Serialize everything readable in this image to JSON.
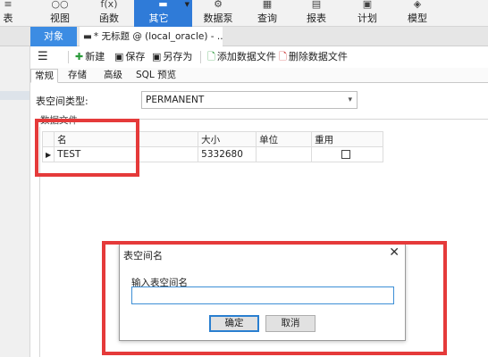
{
  "ribbon": {
    "items": [
      {
        "label": "表",
        "icon": "≡"
      },
      {
        "label": "视图",
        "icon": "○○"
      },
      {
        "label": "函数",
        "icon": "f(x)"
      },
      {
        "label": "其它",
        "icon": "▬"
      },
      {
        "label": "数据泵",
        "icon": "⚙"
      },
      {
        "label": "查询",
        "icon": "▦"
      },
      {
        "label": "报表",
        "icon": "▤"
      },
      {
        "label": "计划",
        "icon": "▣"
      },
      {
        "label": "模型",
        "icon": "◈"
      }
    ],
    "active_color": "#2f7bd8"
  },
  "tabs": {
    "objects_label": "对象",
    "doc_label": "* 无标题 @ (local_oracle) - ..."
  },
  "toolbar": {
    "menu_icon": "☰",
    "new_label": "新建",
    "save_label": "保存",
    "save_as_label": "另存为",
    "add_datafile_label": "添加数据文件",
    "delete_datafile_label": "删除数据文件"
  },
  "subtabs": [
    "常规",
    "存储",
    "高级",
    "SQL 预览"
  ],
  "form": {
    "tablespace_type_label": "表空间类型:",
    "tablespace_type_value": "PERMANENT",
    "datafile_group_label": "数据文件"
  },
  "table": {
    "headers": [
      "名",
      "大小",
      "单位",
      "重用"
    ],
    "rows": [
      {
        "name": "TEST",
        "size": "5332680",
        "unit": "",
        "reuse": false
      }
    ]
  },
  "dialog": {
    "title": "表空间名",
    "close_icon": "✕",
    "input_label": "输入表空间名",
    "input_value": "",
    "ok_label": "确定",
    "cancel_label": "取消"
  },
  "colors": {
    "highlight_red": "#e53a3a",
    "tab_blue": "#3c8ce3"
  }
}
